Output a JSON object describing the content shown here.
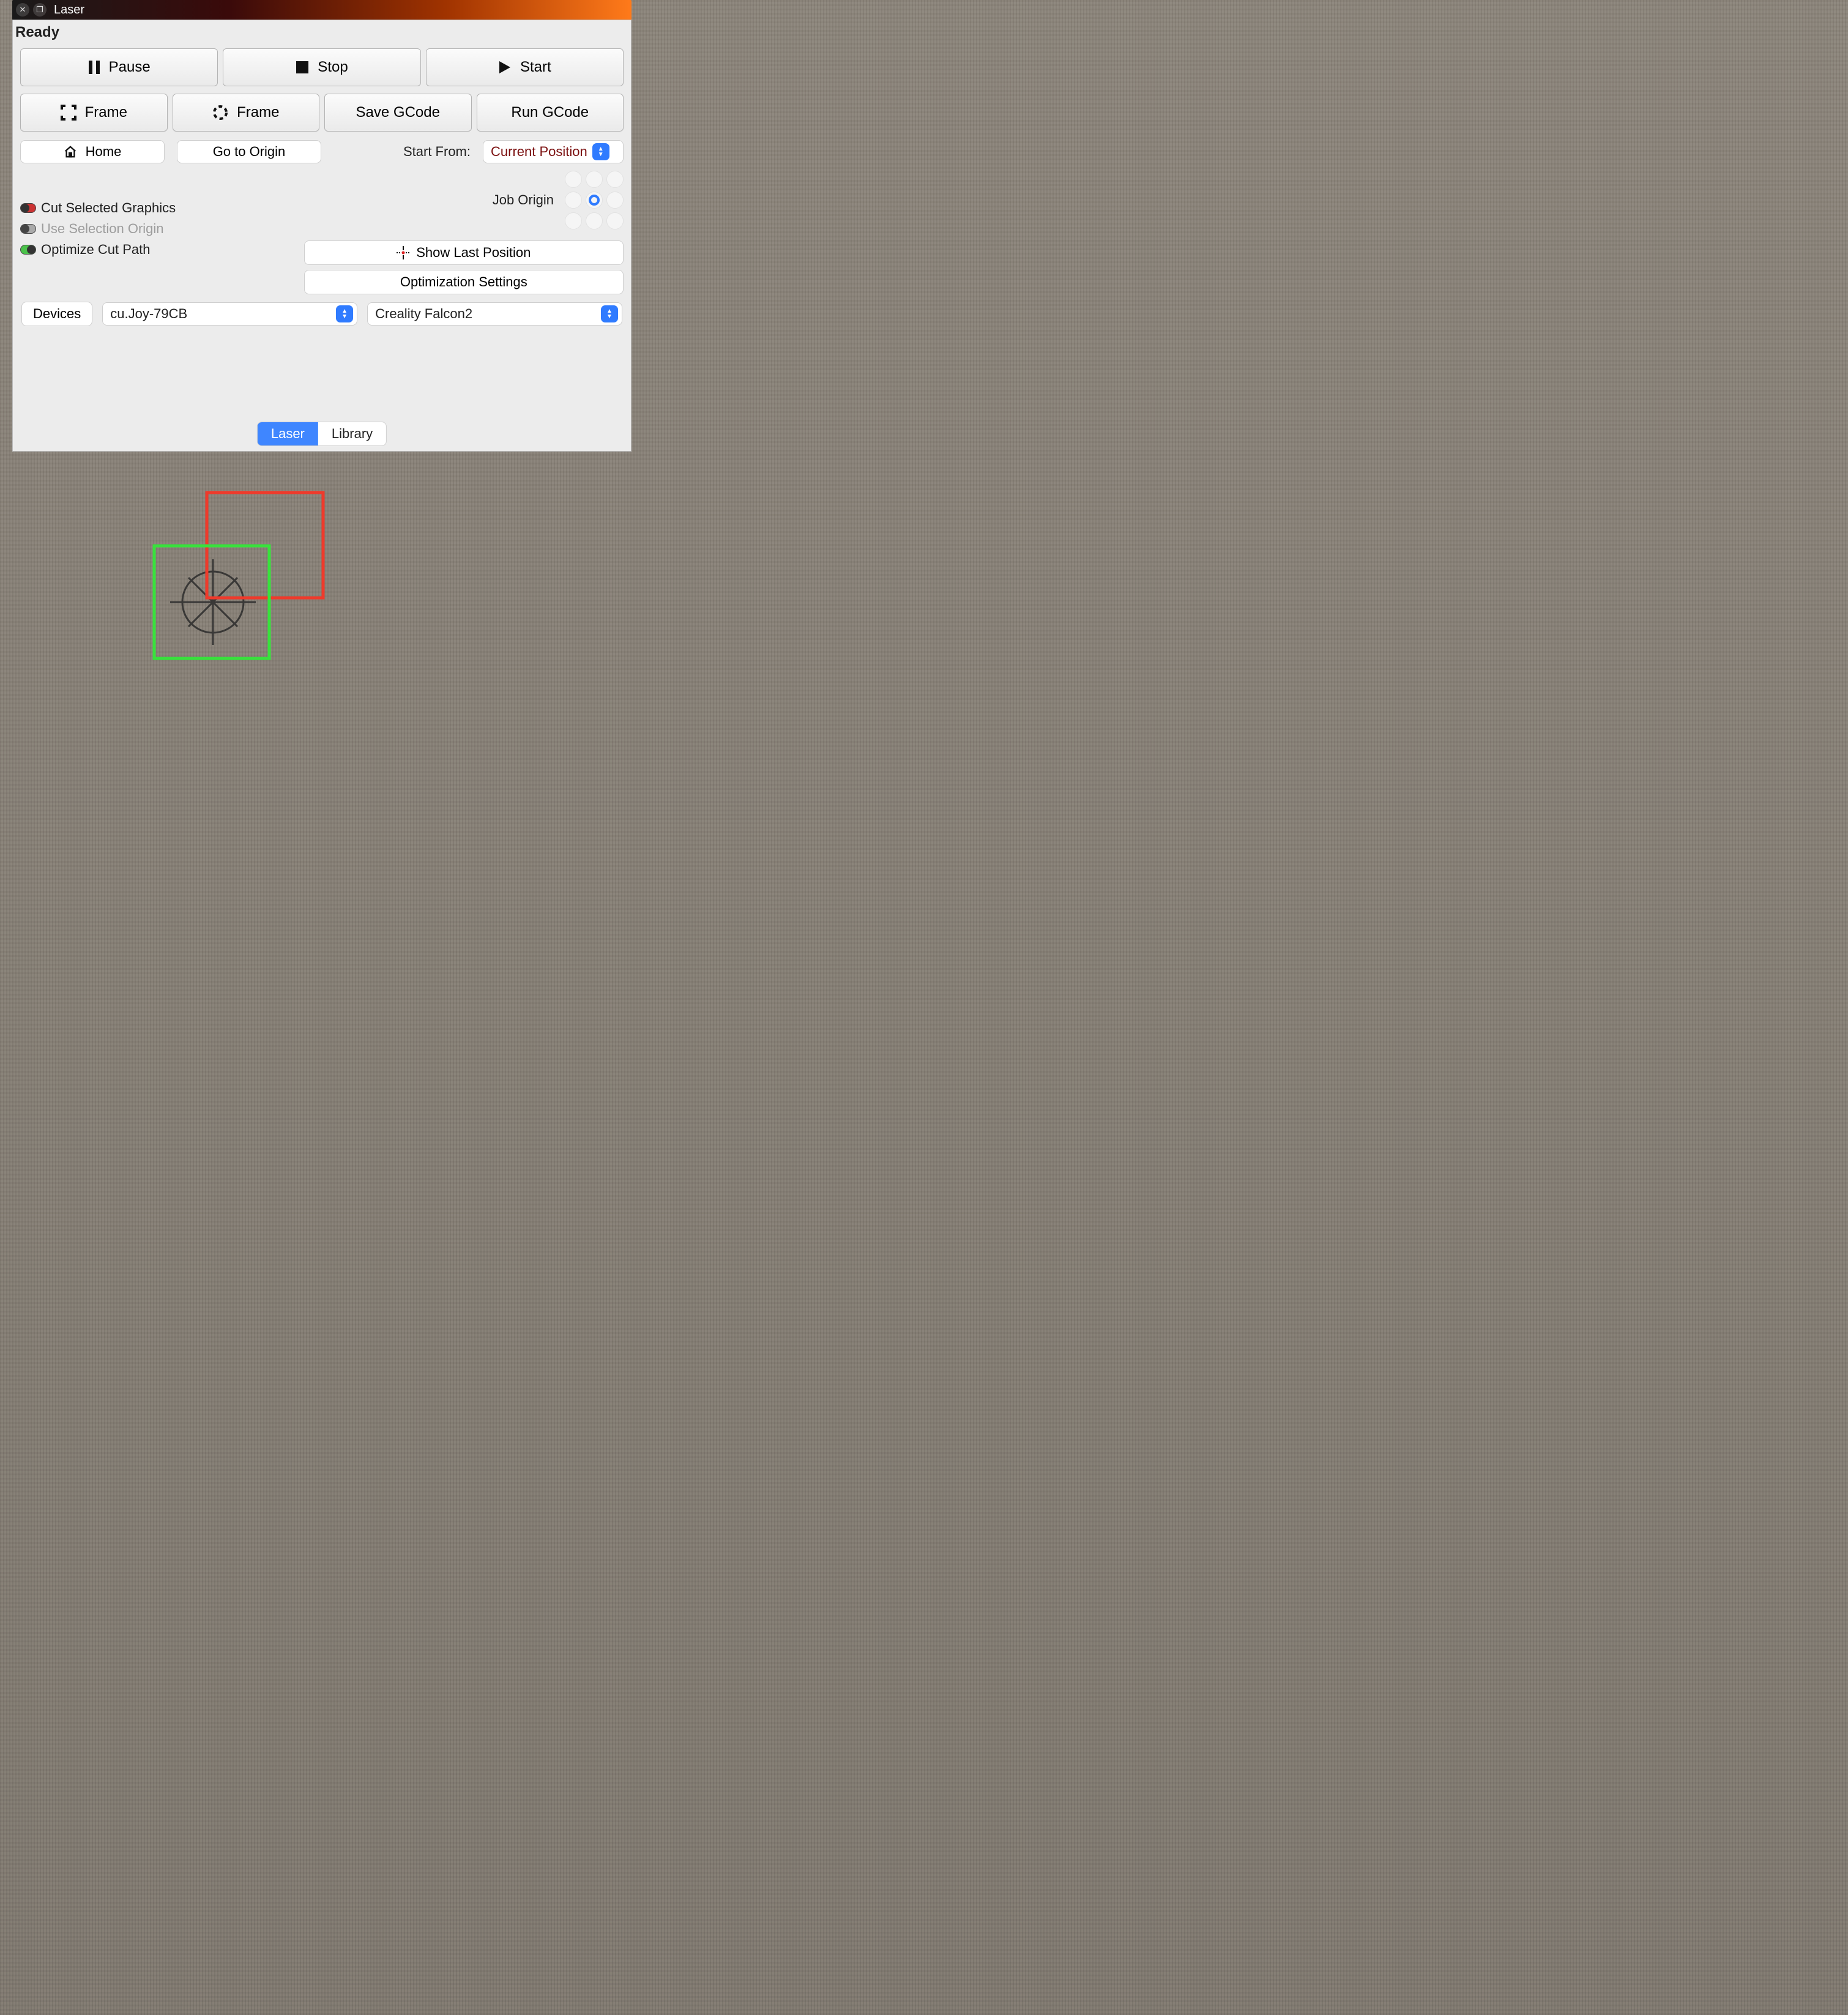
{
  "window": {
    "title": "Laser"
  },
  "status": "Ready",
  "buttons": {
    "pause": "Pause",
    "stop": "Stop",
    "start": "Start",
    "frame_rect": "Frame",
    "frame_circle": "Frame",
    "save_gcode": "Save GCode",
    "run_gcode": "Run GCode",
    "home": "Home",
    "go_to_origin": "Go to Origin",
    "show_last_pos": "Show Last Position",
    "optimization_settings": "Optimization Settings",
    "devices": "Devices"
  },
  "labels": {
    "start_from": "Start From:",
    "job_origin": "Job Origin"
  },
  "toggles": {
    "cut_selected": {
      "label": "Cut Selected Graphics",
      "state": "red"
    },
    "use_selection_origin": {
      "label": "Use Selection Origin",
      "state": "off",
      "disabled": true
    },
    "optimize_cut_path": {
      "label": "Optimize Cut Path",
      "state": "green"
    }
  },
  "start_from_value": "Current Position",
  "job_origin_selected": 4,
  "port_value": "cu.Joy-79CB",
  "device_value": "Creality Falcon2",
  "tabs": {
    "laser": "Laser",
    "library": "Library",
    "active": "laser"
  }
}
